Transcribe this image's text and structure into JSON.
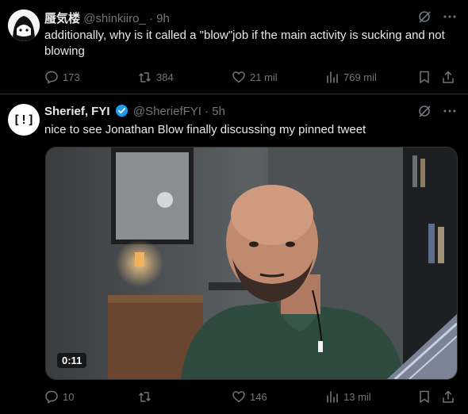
{
  "tweets": [
    {
      "display_name": "蜃気楼",
      "handle": "@shinkiiro_",
      "time": "· 9h",
      "text": "additionally, why is it called a \"blow\"job if the main activity is sucking and not blowing",
      "stats": {
        "replies": "173",
        "reposts": "384",
        "likes": "21 mil",
        "views": "769 mil"
      }
    },
    {
      "display_name": "Sherief, FYI",
      "handle": "@SheriefFYI",
      "time": "· 5h",
      "avatar_text": "[!]",
      "verified": true,
      "text": "nice to see Jonathan Blow finally discussing my pinned tweet",
      "media": {
        "timecode": "0:11"
      },
      "stats": {
        "replies": "10",
        "reposts": "",
        "likes": "146",
        "views": "13 mil"
      }
    }
  ],
  "colors": {
    "background": "#000000",
    "text": "#e7e9ea",
    "muted": "#71767b",
    "verified": "#1d9bf0",
    "divider": "#2f3336"
  }
}
